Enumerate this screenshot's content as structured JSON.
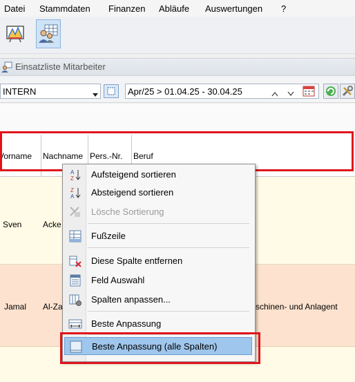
{
  "menubar": {
    "items": [
      {
        "label": "Datei"
      },
      {
        "label": "Stammdaten"
      },
      {
        "label": "Finanzen"
      },
      {
        "label": "Abläufe"
      },
      {
        "label": "Auswertungen"
      },
      {
        "label": "?"
      }
    ]
  },
  "toolbar": {
    "buttons": [
      {
        "icon": "chart-board-icon"
      },
      {
        "icon": "employees-grid-icon"
      }
    ]
  },
  "panel": {
    "title": "Einsatzliste Mitarbeiter",
    "icon": "employees-icon"
  },
  "filter": {
    "group_value": "INTERN",
    "period_value": "Apr/25 > 01.04.25 - 30.04.25"
  },
  "grid": {
    "columns": [
      "Vorname",
      "Nachname",
      "Pers.-Nr.",
      "Beruf"
    ],
    "rows": [
      {
        "vorname": "Sven",
        "nachname": "Acke",
        "beruf": ""
      },
      {
        "vorname": "Jamal",
        "nachname": "Al-Za",
        "beruf": "schinen- und Anlagent"
      }
    ],
    "row_colors": {
      "row1": "#fffbe6",
      "row2": "#fde3cf"
    }
  },
  "context_menu": {
    "items": [
      {
        "label": "Aufsteigend sortieren",
        "icon": "sort-ascending-icon",
        "enabled": true
      },
      {
        "label": "Absteigend sortieren",
        "icon": "sort-descending-icon",
        "enabled": true
      },
      {
        "label": "Lösche Sortierung",
        "icon": "clear-sort-icon",
        "enabled": false
      },
      {
        "label": "Fußzeile",
        "icon": "footer-icon",
        "enabled": true
      },
      {
        "label": "Diese Spalte entfernen",
        "icon": "remove-column-icon",
        "enabled": true
      },
      {
        "label": "Feld Auswahl",
        "icon": "field-chooser-icon",
        "enabled": true
      },
      {
        "label": "Spalten anpassen...",
        "icon": "customize-columns-icon",
        "enabled": true
      },
      {
        "label": "Beste Anpassung",
        "icon": "best-fit-icon",
        "enabled": true
      },
      {
        "label": "Beste Anpassung (alle Spalten)",
        "icon": "best-fit-all-icon",
        "enabled": true,
        "highlighted": true
      }
    ]
  },
  "colors": {
    "highlight_box": "#e0141b",
    "menu_highlight": "#9fc6ec"
  }
}
